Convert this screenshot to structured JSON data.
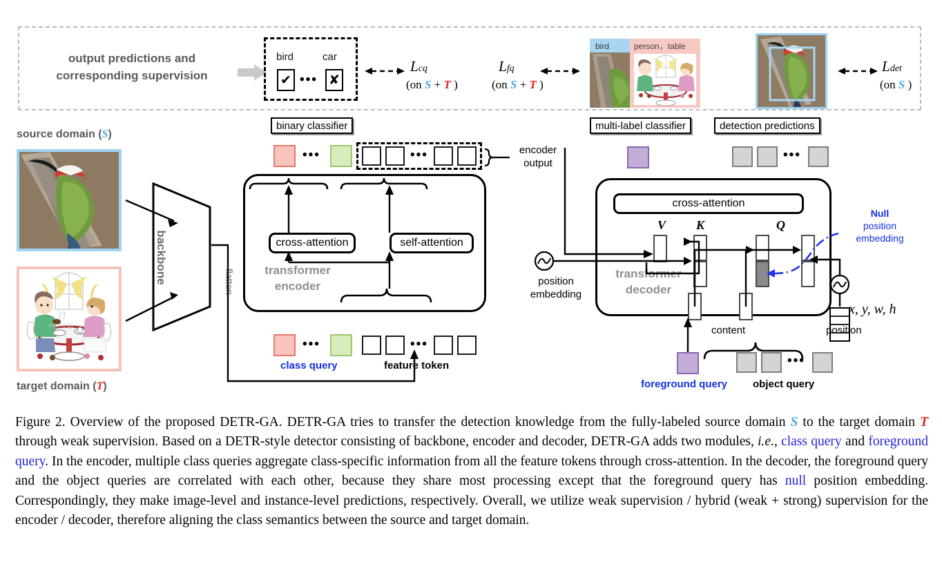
{
  "banner": {
    "text_line1": "output predictions and",
    "text_line2": "corresponding supervision",
    "binary_classifier": {
      "label_bird": "bird",
      "label_car": "car",
      "pred_bird": "✔",
      "pred_car": "✘",
      "dots": "•••"
    },
    "loss_cq": {
      "symbol": "L",
      "sub": "cq",
      "on_prefix": "(on ",
      "s": "S",
      "plus": " + ",
      "t": "T",
      "on_suffix": " )"
    },
    "loss_fq": {
      "symbol": "L",
      "sub": "fq",
      "on_prefix": "(on ",
      "s": "S",
      "plus": " + ",
      "t": "T",
      "on_suffix": " )"
    },
    "loss_det": {
      "symbol": "L",
      "sub": "det",
      "on_prefix": "(on ",
      "s": "S",
      "on_suffix": " )"
    },
    "multilabel_image": {
      "tag_left": "bird",
      "tag_right": "person， table"
    }
  },
  "plates": {
    "binary_classifier": "binary classifier",
    "multi_label_classifier": "multi-label classifier",
    "detection_predictions": "detection predictions"
  },
  "domains": {
    "source_label_prefix": "source domain (",
    "source_symbol": "S",
    "source_label_suffix": ")",
    "target_label_prefix": "target domain (",
    "target_symbol": "T",
    "target_label_suffix": ")"
  },
  "backbone": {
    "label": "backbone",
    "flatten": "flatten"
  },
  "encoder": {
    "title_line1": "transformer",
    "title_line2": "encoder",
    "cross_attention": "cross-attention",
    "self_attention": "self-attention",
    "encoder_output_line1": "encoder",
    "encoder_output_line2": "output",
    "class_query_label": "class query",
    "feature_token_label": "feature token",
    "dots": "•••"
  },
  "decoder": {
    "title_line1": "transformer",
    "title_line2": "decoder",
    "cross_attention": "cross-attention",
    "v_label": "V",
    "k_label": "K",
    "q_label": "Q",
    "null_bold": "Null",
    "null_line2": "position",
    "null_line3": "embedding",
    "position_embedding_line1": "position",
    "position_embedding_line2": "embedding",
    "content_label": "content",
    "position_label": "position",
    "xywh_label": "x, y, w, h",
    "foreground_query_label": "foreground query",
    "object_query_label": "object query",
    "dots": "•••"
  },
  "colors": {
    "class_query_red_fill": "#f8c4bd",
    "class_query_red_border": "#e8776c",
    "class_query_green_fill": "#d7ebbd",
    "class_query_green_border": "#9cc96f",
    "object_query_grey_fill": "#d4d4d4",
    "foreground_query_purple_fill": "#c4aed8",
    "source_frame_blue": "#9fd3f2",
    "target_frame_pink": "#f6c3bb",
    "accent_blue": "#1630e0",
    "caption_blue": "#2222dd",
    "source_symbol_blue": "#4aa7e8",
    "target_symbol_red": "#e8231a",
    "muted_grey": "#8f8f8f"
  },
  "caption": {
    "p1": "Figure 2. Overview of the proposed DETR-GA. DETR-GA tries to transfer the detection knowledge from the fully-labeled source domain ",
    "s_sym": "S",
    "p2": " to the target domain ",
    "t_sym": "T",
    "p3": " through weak supervision. Based on a DETR-style detector consisting of backbone, encoder and decoder, DETR-GA adds two modules, ",
    "ie": "i.e.",
    "p4": ", ",
    "blue1": "class query",
    "p5": " and ",
    "blue2": "foreground query",
    "p6": ". In the encoder, multiple class queries aggregate class-specific information from all the feature tokens through cross-attention. In the decoder, the foreground query and the object queries are correlated with each other, because they share most processing except that the foreground query has ",
    "blue3": "null",
    "p7": " position embedding. Correspondingly, they make image-level and instance-level predictions, respectively. Overall, we utilize weak supervision / hybrid (weak + strong) supervision for the encoder / decoder, therefore aligning the class semantics between the source and target domain."
  }
}
